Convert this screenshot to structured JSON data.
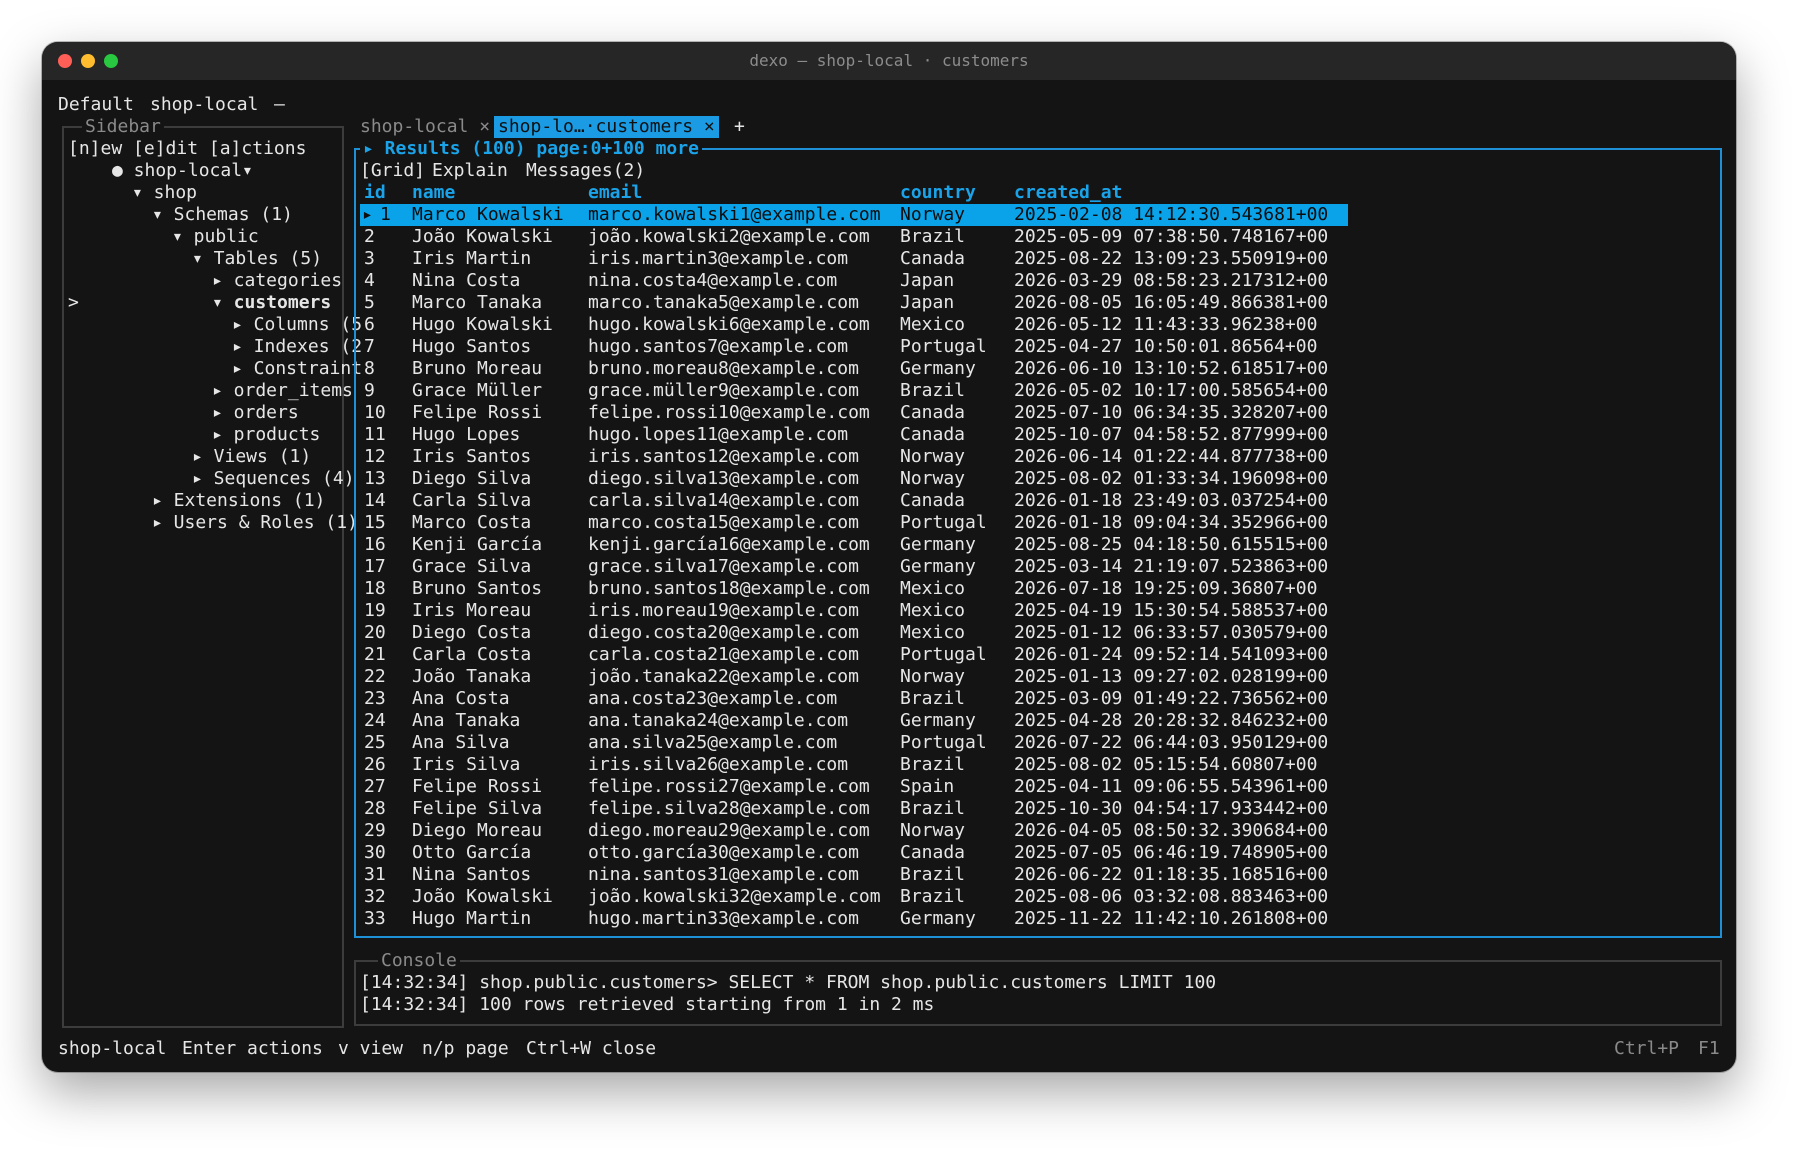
{
  "window": {
    "title": "dexo — shop-local · customers"
  },
  "topbar": {
    "profile": "Default",
    "connection": "shop-local",
    "dash": "—"
  },
  "sidebar": {
    "legend": "Sidebar",
    "menu": "[n]ew [e]dit [a]ctions",
    "cursor": ">",
    "tree": [
      {
        "text": "● shop-local▾",
        "bold": false
      },
      {
        "text": "▾ shop",
        "bold": false
      },
      {
        "text": "▾ Schemas (1)",
        "bold": false
      },
      {
        "text": "▾ public",
        "bold": false
      },
      {
        "text": "▾ Tables (5)",
        "bold": false
      },
      {
        "text": "▸ categories",
        "bold": false
      },
      {
        "text": "▾ customers",
        "bold": true
      },
      {
        "text": "▸ Columns (5",
        "bold": false
      },
      {
        "text": "▸ Indexes (2",
        "bold": false
      },
      {
        "text": "▸ Constraint",
        "bold": false
      },
      {
        "text": "▸ order_items",
        "bold": false
      },
      {
        "text": "▸ orders",
        "bold": false
      },
      {
        "text": "▸ products",
        "bold": false
      },
      {
        "text": "▸ Views (1)",
        "bold": false
      },
      {
        "text": "▸ Sequences (4)",
        "bold": false
      },
      {
        "text": "▸ Extensions (1)",
        "bold": false
      },
      {
        "text": "▸ Users & Roles (1)",
        "bold": false
      }
    ]
  },
  "tabs": {
    "tab1": "shop-local",
    "tab1_close": "×",
    "tab2": "shop-lo…·customers ×",
    "add": "+"
  },
  "results": {
    "legend": "▸ Results (100) page:0+100 more",
    "subtabs": {
      "grid": "[Grid]",
      "explain": "Explain",
      "messages": "Messages(2)"
    },
    "columns": {
      "id": "id",
      "name": "name",
      "email": "email",
      "country": "country",
      "created_at": "created_at"
    },
    "selected_marker": "▸",
    "rows": [
      {
        "id": "1",
        "name": "Marco Kowalski",
        "email": "marco.kowalski1@example.com",
        "country": "Norway",
        "created_at": "2025-02-08 14:12:30.543681+00"
      },
      {
        "id": "2",
        "name": "João Kowalski",
        "email": "joão.kowalski2@example.com",
        "country": "Brazil",
        "created_at": "2025-05-09 07:38:50.748167+00"
      },
      {
        "id": "3",
        "name": "Iris Martin",
        "email": "iris.martin3@example.com",
        "country": "Canada",
        "created_at": "2025-08-22 13:09:23.550919+00"
      },
      {
        "id": "4",
        "name": "Nina Costa",
        "email": "nina.costa4@example.com",
        "country": "Japan",
        "created_at": "2026-03-29 08:58:23.217312+00"
      },
      {
        "id": "5",
        "name": "Marco Tanaka",
        "email": "marco.tanaka5@example.com",
        "country": "Japan",
        "created_at": "2026-08-05 16:05:49.866381+00"
      },
      {
        "id": "6",
        "name": "Hugo Kowalski",
        "email": "hugo.kowalski6@example.com",
        "country": "Mexico",
        "created_at": "2026-05-12 11:43:33.96238+00"
      },
      {
        "id": "7",
        "name": "Hugo Santos",
        "email": "hugo.santos7@example.com",
        "country": "Portugal",
        "created_at": "2025-04-27 10:50:01.86564+00"
      },
      {
        "id": "8",
        "name": "Bruno Moreau",
        "email": "bruno.moreau8@example.com",
        "country": "Germany",
        "created_at": "2026-06-10 13:10:52.618517+00"
      },
      {
        "id": "9",
        "name": "Grace Müller",
        "email": "grace.müller9@example.com",
        "country": "Brazil",
        "created_at": "2026-05-02 10:17:00.585654+00"
      },
      {
        "id": "10",
        "name": "Felipe Rossi",
        "email": "felipe.rossi10@example.com",
        "country": "Canada",
        "created_at": "2025-07-10 06:34:35.328207+00"
      },
      {
        "id": "11",
        "name": "Hugo Lopes",
        "email": "hugo.lopes11@example.com",
        "country": "Canada",
        "created_at": "2025-10-07 04:58:52.877999+00"
      },
      {
        "id": "12",
        "name": "Iris Santos",
        "email": "iris.santos12@example.com",
        "country": "Norway",
        "created_at": "2026-06-14 01:22:44.877738+00"
      },
      {
        "id": "13",
        "name": "Diego Silva",
        "email": "diego.silva13@example.com",
        "country": "Norway",
        "created_at": "2025-08-02 01:33:34.196098+00"
      },
      {
        "id": "14",
        "name": "Carla Silva",
        "email": "carla.silva14@example.com",
        "country": "Canada",
        "created_at": "2026-01-18 23:49:03.037254+00"
      },
      {
        "id": "15",
        "name": "Marco Costa",
        "email": "marco.costa15@example.com",
        "country": "Portugal",
        "created_at": "2026-01-18 09:04:34.352966+00"
      },
      {
        "id": "16",
        "name": "Kenji García",
        "email": "kenji.garcía16@example.com",
        "country": "Germany",
        "created_at": "2025-08-25 04:18:50.615515+00"
      },
      {
        "id": "17",
        "name": "Grace Silva",
        "email": "grace.silva17@example.com",
        "country": "Germany",
        "created_at": "2025-03-14 21:19:07.523863+00"
      },
      {
        "id": "18",
        "name": "Bruno Santos",
        "email": "bruno.santos18@example.com",
        "country": "Mexico",
        "created_at": "2026-07-18 19:25:09.36807+00"
      },
      {
        "id": "19",
        "name": "Iris Moreau",
        "email": "iris.moreau19@example.com",
        "country": "Mexico",
        "created_at": "2025-04-19 15:30:54.588537+00"
      },
      {
        "id": "20",
        "name": "Diego Costa",
        "email": "diego.costa20@example.com",
        "country": "Mexico",
        "created_at": "2025-01-12 06:33:57.030579+00"
      },
      {
        "id": "21",
        "name": "Carla Costa",
        "email": "carla.costa21@example.com",
        "country": "Portugal",
        "created_at": "2026-01-24 09:52:14.541093+00"
      },
      {
        "id": "22",
        "name": "João Tanaka",
        "email": "joão.tanaka22@example.com",
        "country": "Norway",
        "created_at": "2025-01-13 09:27:02.028199+00"
      },
      {
        "id": "23",
        "name": "Ana Costa",
        "email": "ana.costa23@example.com",
        "country": "Brazil",
        "created_at": "2025-03-09 01:49:22.736562+00"
      },
      {
        "id": "24",
        "name": "Ana Tanaka",
        "email": "ana.tanaka24@example.com",
        "country": "Germany",
        "created_at": "2025-04-28 20:28:32.846232+00"
      },
      {
        "id": "25",
        "name": "Ana Silva",
        "email": "ana.silva25@example.com",
        "country": "Portugal",
        "created_at": "2026-07-22 06:44:03.950129+00"
      },
      {
        "id": "26",
        "name": "Iris Silva",
        "email": "iris.silva26@example.com",
        "country": "Brazil",
        "created_at": "2025-08-02 05:15:54.60807+00"
      },
      {
        "id": "27",
        "name": "Felipe Rossi",
        "email": "felipe.rossi27@example.com",
        "country": "Spain",
        "created_at": "2025-04-11 09:06:55.543961+00"
      },
      {
        "id": "28",
        "name": "Felipe Silva",
        "email": "felipe.silva28@example.com",
        "country": "Brazil",
        "created_at": "2025-10-30 04:54:17.933442+00"
      },
      {
        "id": "29",
        "name": "Diego Moreau",
        "email": "diego.moreau29@example.com",
        "country": "Norway",
        "created_at": "2026-04-05 08:50:32.390684+00"
      },
      {
        "id": "30",
        "name": "Otto García",
        "email": "otto.garcía30@example.com",
        "country": "Canada",
        "created_at": "2025-07-05 06:46:19.748905+00"
      },
      {
        "id": "31",
        "name": "Nina Santos",
        "email": "nina.santos31@example.com",
        "country": "Brazil",
        "created_at": "2026-06-22 01:18:35.168516+00"
      },
      {
        "id": "32",
        "name": "João Kowalski",
        "email": "joão.kowalski32@example.com",
        "country": "Brazil",
        "created_at": "2025-08-06 03:32:08.883463+00"
      },
      {
        "id": "33",
        "name": "Hugo Martin",
        "email": "hugo.martin33@example.com",
        "country": "Germany",
        "created_at": "2025-11-22 11:42:10.261808+00"
      }
    ]
  },
  "console": {
    "legend": "Console",
    "lines": [
      "[14:32:34] shop.public.customers> SELECT * FROM shop.public.customers LIMIT 100",
      "[14:32:34] 100 rows retrieved starting from 1 in 2 ms"
    ]
  },
  "footer": {
    "connection": "shop-local",
    "enter": "Enter actions",
    "view": "v view",
    "page": "n/p page",
    "close": "Ctrl+W close",
    "palette": "Ctrl+P",
    "help": "F1"
  },
  "colors": {
    "accent": "#1aa3e8",
    "selection": "#0aa3ea",
    "background": "#141414"
  }
}
